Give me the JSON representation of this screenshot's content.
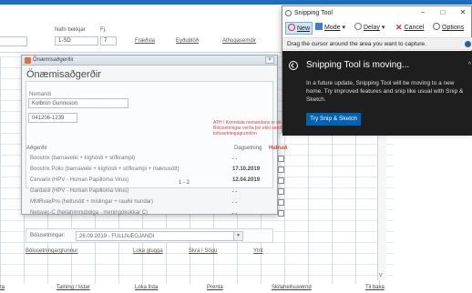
{
  "app": {
    "header": {
      "fields": [
        {
          "label": "Nafn bekkjar",
          "value": "1-SD"
        },
        {
          "label": "Fj.",
          "value": "7"
        }
      ],
      "links": [
        "Fræðsla",
        "Eyðublöð",
        "Athugasemdir"
      ]
    },
    "footer": [
      "ta",
      "Talning / listar",
      "Loka lista",
      "Prenta",
      "Skilaheilsuvernd",
      "Til baka"
    ],
    "scroll_glyph": "v"
  },
  "dialog": {
    "window_title": "Önæmisaðgerðir",
    "heading": "Önæmisaðgerðir",
    "name_label": "Nemandi",
    "name_value": "Kolbrún Gunnuson",
    "kennitala": "041206-1239",
    "warning": "ATH ! Kennitala nemandans er ekki gild! Bólusetningar verða því ekki sendar í bólusetningagrunninn",
    "columns": {
      "a": "Aðgerðir",
      "d": "Dagsetning",
      "h": "Hafnað"
    },
    "rows": [
      {
        "name": "Boostrix (barnaveiki + kíghósti + stífkrampi)",
        "date": ". ."
      },
      {
        "name": "Boostrix Polio (barnaveiki + kíghósti + stífkrampi + mænusótt)",
        "date": "17.10.2019"
      },
      {
        "name": "Cervarix (HPV - Human Papilloma Virus)",
        "date": "12.04.2019"
      },
      {
        "name": "Gardasil (HPV - Human Papilloma Virus)",
        "date": ". ."
      },
      {
        "name": "MMRvaxPro (hettusótt + mislingar + rauðir hundar)",
        "date": ". ."
      },
      {
        "name": "Neisvac-C (heilahimnubólga - meningókokkar C)",
        "date": ". ."
      }
    ],
    "dose": "1 - 2",
    "vacc_label": "Bólusetningar:",
    "vacc_value": "26.09.2019 - FULLNÆGJANDI",
    "links": [
      "Bólusetningargrunnur",
      "Loka glugga",
      "Skrá í Sögu",
      "Ytrit"
    ],
    "close_label": "×"
  },
  "snipping": {
    "title": "Snipping Tool",
    "win_buttons": [
      "–",
      "□",
      "✕"
    ],
    "toolbar": {
      "new": "New",
      "mode": "Mode",
      "delay": "Delay",
      "cancel": "Cancel",
      "options": "Options"
    },
    "hint": "Drag the cursor around the area you want to capture.",
    "banner_title": "Snipping Tool is moving...",
    "banner_body": "In a future update, Snipping Tool will be moving to a new home. Try improved features and snip like usual with Snip & Sketch.",
    "banner_button": "Try Snip & Sketch",
    "chevron": "^"
  }
}
